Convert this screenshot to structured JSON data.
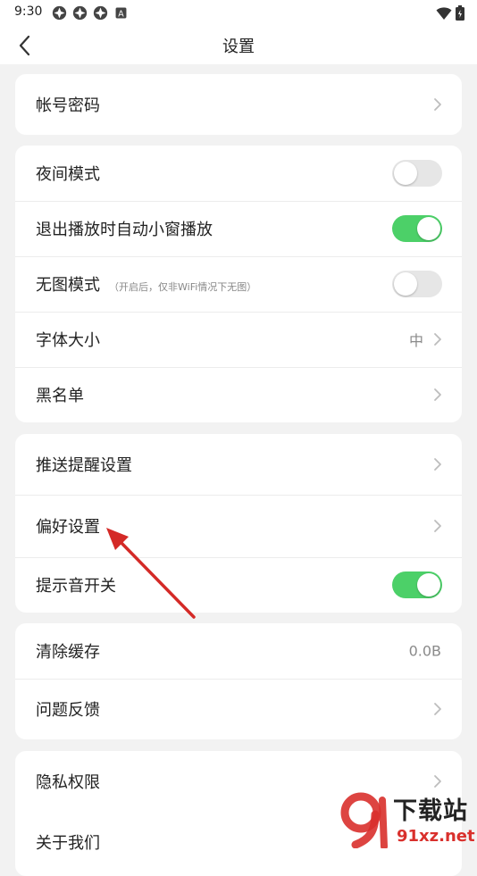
{
  "status_bar": {
    "time": "9:30",
    "small_badge": "A"
  },
  "header": {
    "title": "设置"
  },
  "groups": {
    "account": {
      "account_password": "帐号密码"
    },
    "display": {
      "night_mode": {
        "label": "夜间模式",
        "on": false
      },
      "auto_mini_window": {
        "label": "退出播放时自动小窗播放",
        "on": true
      },
      "no_image_mode": {
        "label": "无图模式",
        "note": "（开启后，仅非WiFi情况下无图）",
        "on": false
      },
      "font_size": {
        "label": "字体大小",
        "value": "中"
      },
      "blacklist": {
        "label": "黑名单"
      }
    },
    "notify": {
      "push_settings": {
        "label": "推送提醒设置"
      },
      "preferences": {
        "label": "偏好设置"
      },
      "sound_switch": {
        "label": "提示音开关",
        "on": true
      }
    },
    "storage": {
      "clear_cache": {
        "label": "清除缓存",
        "value": "0.0B"
      },
      "feedback": {
        "label": "问题反馈"
      }
    },
    "about": {
      "privacy": {
        "label": "隐私权限"
      },
      "about_us": {
        "label": "关于我们"
      }
    }
  },
  "watermark": {
    "brand_cn": "下载站",
    "domain": "91xz.net"
  },
  "colors": {
    "toggle_on": "#4cd068",
    "toggle_off": "#e6e6e6",
    "annotation_arrow": "#d42a27"
  }
}
